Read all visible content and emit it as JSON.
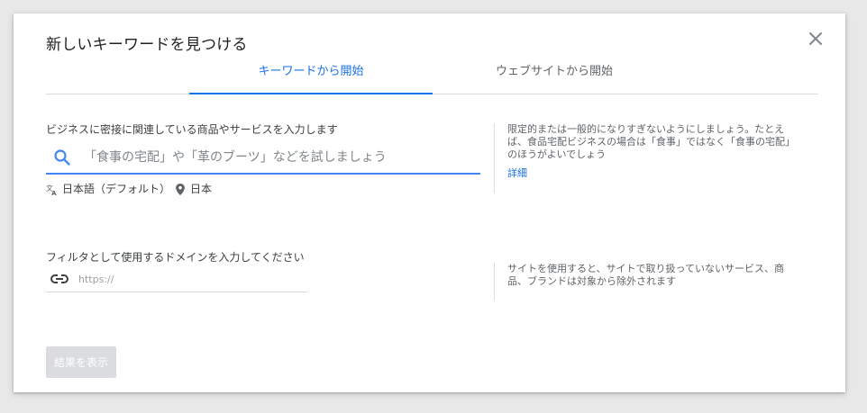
{
  "dialog": {
    "title": "新しいキーワードを見つける"
  },
  "icons": {
    "close": "close-icon",
    "search": "search-icon",
    "translate": "translate-icon",
    "location": "location-pin-icon",
    "link": "link-icon"
  },
  "tabs": [
    {
      "label": "キーワードから開始",
      "active": true
    },
    {
      "label": "ウェブサイトから開始",
      "active": false
    }
  ],
  "keywords": {
    "label": "ビジネスに密接に関連している商品やサービスを入力します",
    "placeholder": "「食事の宅配」や「革のブーツ」などを試しましょう",
    "value": "",
    "language": "日本語（デフォルト）",
    "location": "日本",
    "help": {
      "line1": "限定的または一般的になりすぎないようにしましょう。たとえ",
      "line2": "ば、食品宅配ビジネスの場合は「食事」ではなく「食事の宅配」",
      "line3": "のほうがよいでしょう",
      "link": "詳細"
    }
  },
  "domain": {
    "label": "フィルタとして使用するドメインを入力してください",
    "placeholder": "https://",
    "value": "",
    "help": {
      "line1": "サイトを使用すると、サイトで取り扱っていないサービス、商",
      "line2": "品、ブランドは対象から除外されます"
    }
  },
  "submit": {
    "label": "結果を表示",
    "enabled": false
  },
  "colors": {
    "accent": "#1a73e8",
    "input_focus": "#4285f4",
    "disabled_button": "#dadce0",
    "background": "#e8e8e8"
  }
}
